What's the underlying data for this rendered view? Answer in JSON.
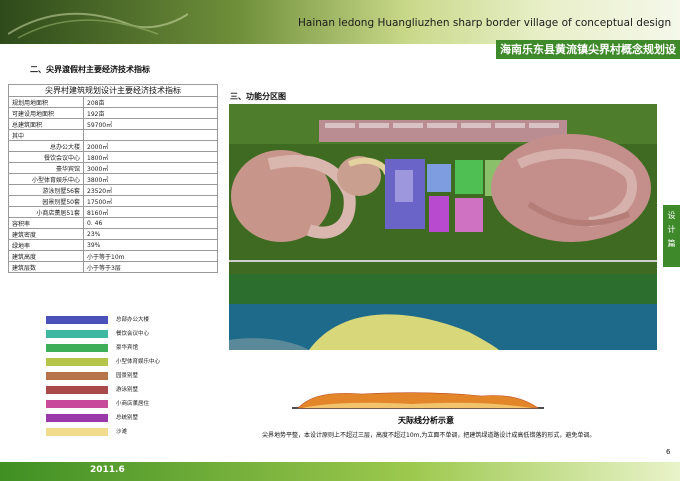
{
  "header": {
    "title_en": "Hainan ledong Huangliuzhen sharp border village of conceptual design",
    "title_cn": "海南乐东县黄流镇尖界村概念规划设计"
  },
  "section2_title": "二、尖界渡假村主要经济技术指标",
  "section3_title": "三、功能分区图",
  "table": {
    "title": "尖界村建筑规划设计主要经济技术指标",
    "rows": [
      {
        "label": "规划用地面积",
        "value": "208亩",
        "indent": false
      },
      {
        "label": "可建设用地面积",
        "value": "192亩",
        "indent": false
      },
      {
        "label": "总建筑面积",
        "value": "59700㎡",
        "indent": false
      },
      {
        "label": "其中",
        "value": "",
        "indent": false
      },
      {
        "label": "总办公大楼",
        "value": "2000㎡",
        "indent": true
      },
      {
        "label": "餐饮会议中心",
        "value": "1800㎡",
        "indent": true
      },
      {
        "label": "豪华宾馆",
        "value": "3000㎡",
        "indent": true
      },
      {
        "label": "小型体育娱乐中心",
        "value": "3800㎡",
        "indent": true
      },
      {
        "label": "游泳别墅56套",
        "value": "23520㎡",
        "indent": true
      },
      {
        "label": "园景别墅50套",
        "value": "17500㎡",
        "indent": true
      },
      {
        "label": "小商店薰居51套",
        "value": "8160㎡",
        "indent": true
      },
      {
        "label": "容积率",
        "value": "0. 46",
        "indent": false
      },
      {
        "label": "建筑密度",
        "value": "23%",
        "indent": false
      },
      {
        "label": "绿地率",
        "value": "39%",
        "indent": false
      },
      {
        "label": "建筑高度",
        "value": "小于等于10m",
        "indent": false
      },
      {
        "label": "建筑层数",
        "value": "小于等于3层",
        "indent": false
      }
    ]
  },
  "legend": [
    {
      "label": "总部办公大楼",
      "color": "#4a52b8"
    },
    {
      "label": "餐饮会议中心",
      "color": "#3fb8a2"
    },
    {
      "label": "豪华宾馆",
      "color": "#3fae58"
    },
    {
      "label": "小型体育娱乐中心",
      "color": "#b5c54a"
    },
    {
      "label": "园景别墅",
      "color": "#b8734a"
    },
    {
      "label": "游泳别墅",
      "color": "#a84a4a"
    },
    {
      "label": "小商店薰居住",
      "color": "#c84a9a"
    },
    {
      "label": "总统别墅",
      "color": "#9a3aa8"
    },
    {
      "label": "沙滩",
      "color": "#f0dc8a"
    }
  ],
  "skyline_title": "天际线分析示意",
  "note": "尖界地势平整，本设计原则上不超过三层，高度不超过10m,为立面不单调，把建筑绿道路设计成高低错落的形式，避免单调。",
  "side_tab": "设计篇",
  "page_number": "6",
  "footer_date": "2011.6"
}
